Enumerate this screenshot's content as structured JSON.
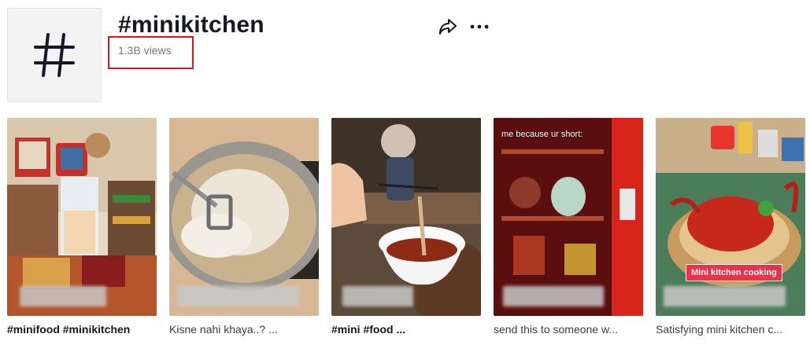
{
  "header": {
    "title": "#minikitchen",
    "views": "1.3B views",
    "avatar_icon": "hashtag-icon",
    "share_icon": "share-icon",
    "more_icon": "more-icon",
    "highlight_color": "#e8121b"
  },
  "videos": [
    {
      "caption": "#minifood #minikitchen",
      "caption_style": "bold"
    },
    {
      "caption": "Kisne nahi khaya..? ...",
      "caption_style": "regular"
    },
    {
      "caption": "#mini #food ...",
      "caption_style": "bold"
    },
    {
      "caption": "send this to someone w...",
      "caption_style": "regular",
      "overlay_text": "me because ur short:"
    },
    {
      "caption": "Satisfying mini kitchen c...",
      "caption_style": "regular",
      "badge": "Mini kitchen cooking"
    }
  ]
}
